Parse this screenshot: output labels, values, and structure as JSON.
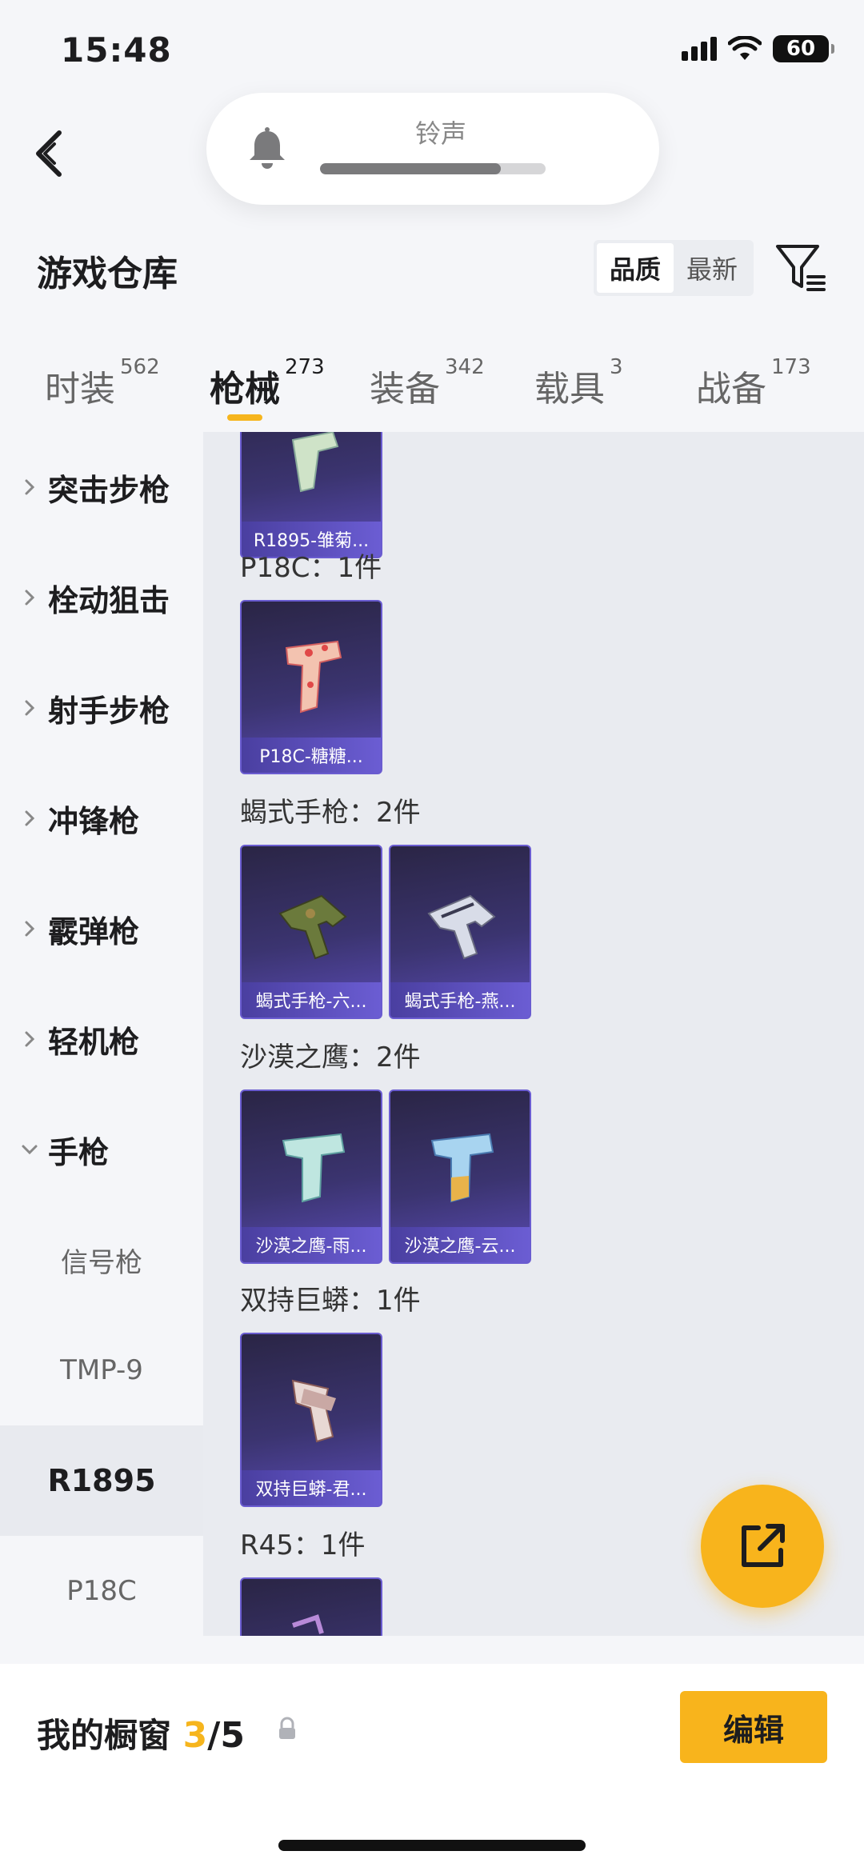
{
  "status_bar": {
    "time": "15:48",
    "battery": "60"
  },
  "volume_hud": {
    "label": "铃声",
    "level": 0.8
  },
  "header": {
    "title": "游戏仓库",
    "sort_options": [
      "品质",
      "最新"
    ],
    "active_sort": "品质"
  },
  "tabs": [
    {
      "label": "时装",
      "count": "562"
    },
    {
      "label": "枪械",
      "count": "273"
    },
    {
      "label": "装备",
      "count": "342"
    },
    {
      "label": "载具",
      "count": "3"
    },
    {
      "label": "战备",
      "count": "173"
    }
  ],
  "sidebar": {
    "categories": [
      "突击步枪",
      "栓动狙击",
      "射手步枪",
      "冲锋枪",
      "霰弹枪",
      "轻机枪",
      "手枪"
    ],
    "subcategories": [
      "信号枪",
      "TMP-9",
      "R1895",
      "P18C"
    ],
    "active_subcategory": "R1895"
  },
  "groups": [
    {
      "title": "",
      "items": [
        "R1895-雏菊..."
      ]
    },
    {
      "title": "P18C：1件",
      "items": [
        "P18C-糖糖..."
      ]
    },
    {
      "title": "蝎式手枪：2件",
      "items": [
        "蝎式手枪-六...",
        "蝎式手枪-燕..."
      ]
    },
    {
      "title": "沙漠之鹰：2件",
      "items": [
        "沙漠之鹰-雨...",
        "沙漠之鹰-云..."
      ]
    },
    {
      "title": "双持巨蟒：1件",
      "items": [
        "双持巨蟒-君..."
      ]
    },
    {
      "title": "R45：1件",
      "items": [
        ""
      ]
    }
  ],
  "bottom_bar": {
    "label": "我的橱窗",
    "current": "3",
    "total": "/5",
    "edit_label": "编辑"
  },
  "colors": {
    "accent": "#f8b41c",
    "card_purple": "#3b3470"
  },
  "icons": {
    "back": "chevron-left-icon",
    "bell": "bell-icon",
    "filter": "filter-icon",
    "share": "share-icon",
    "lock": "lock-icon"
  }
}
